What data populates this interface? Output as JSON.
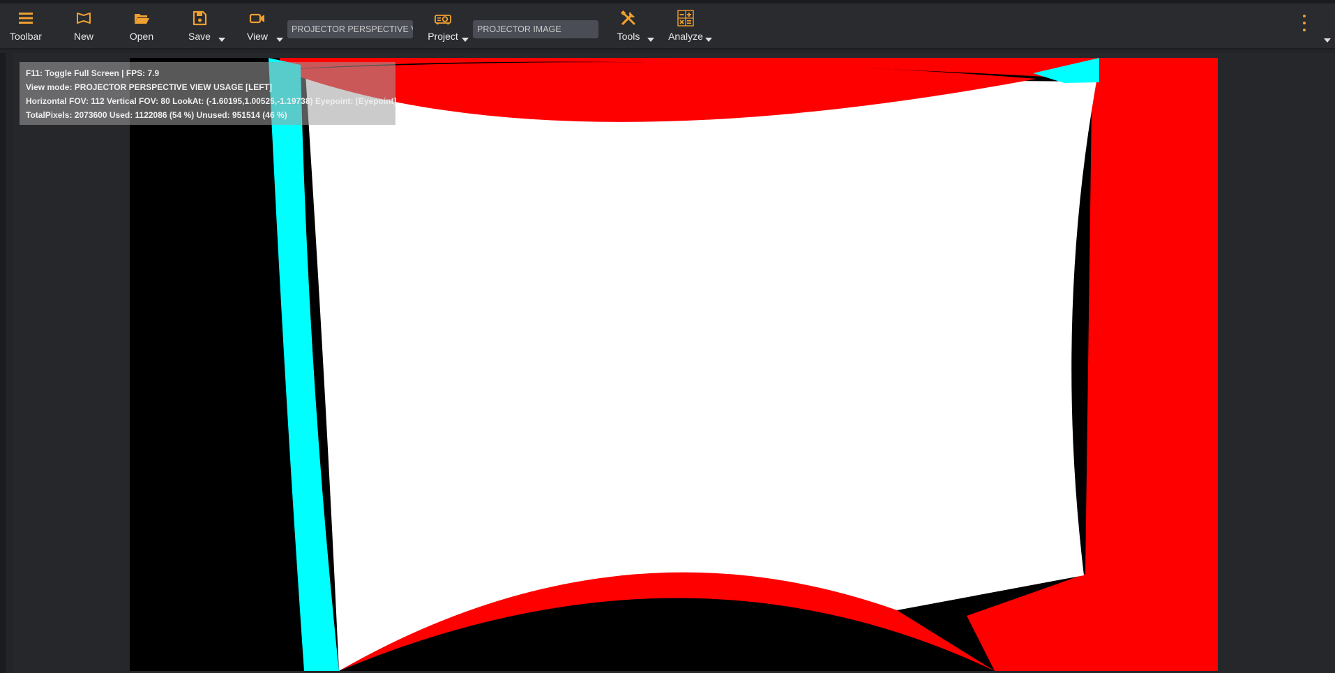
{
  "toolbar": {
    "buttons": [
      {
        "label": "Toolbar",
        "icon": "menu-icon"
      },
      {
        "label": "New",
        "icon": "new-icon"
      },
      {
        "label": "Open",
        "icon": "folder-open-icon"
      },
      {
        "label": "Save",
        "icon": "save-icon"
      },
      {
        "label": "View",
        "icon": "video-camera-icon"
      },
      {
        "label": "Project",
        "icon": "projector-icon"
      },
      {
        "label": "Tools",
        "icon": "tools-icon"
      },
      {
        "label": "Analyze",
        "icon": "calculator-icon"
      }
    ],
    "view_combo_value": "PROJECTOR PERSPECTIVE VIEW USAGE",
    "project_combo_value": "PROJECTOR IMAGE",
    "accent_color": "#f0a030",
    "more_icon": "more-vertical-icon"
  },
  "overlay": {
    "line1": "F11: Toggle Full Screen | FPS: 7.9",
    "line2": "View mode: PROJECTOR PERSPECTIVE VIEW USAGE [LEFT]",
    "line3": "Horizontal FOV: 112 Vertical FOV: 80 LookAt: (-1.60195,1.00525,-1.19738) Eyepoint: [Eyepoint]",
    "line4": "TotalPixels: 2073600 Used: 1122086 (54 %) Unused: 951514 (46 %)"
  },
  "render": {
    "used_color": "#ffffff",
    "overlap_colors": [
      "#ff0000",
      "#00ffff"
    ],
    "background_color": "#000000"
  }
}
